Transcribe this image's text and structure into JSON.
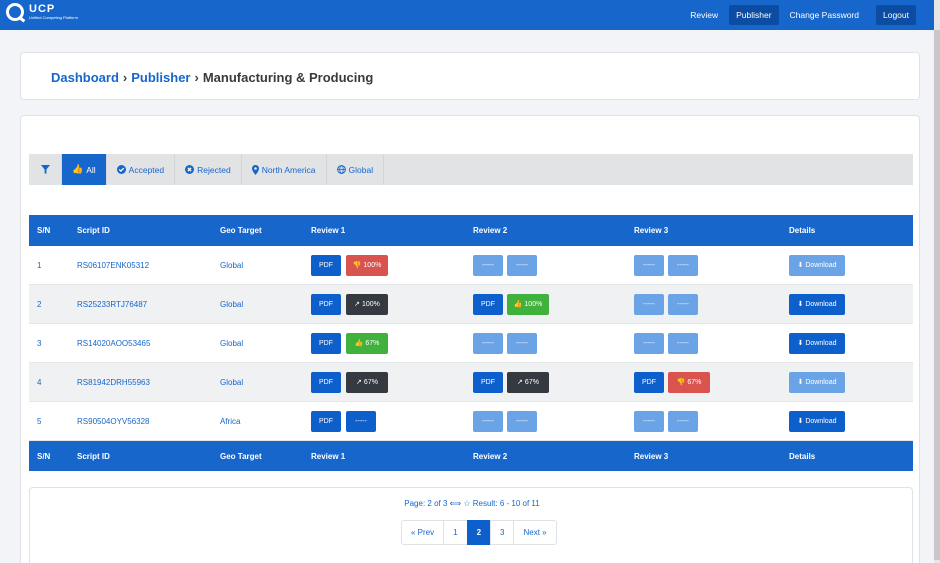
{
  "brand": {
    "name": "UCP",
    "tagline": "Unified Competing Platform"
  },
  "nav": {
    "review": "Review",
    "publisher": "Publisher",
    "change_password": "Change Password",
    "logout": "Logout"
  },
  "breadcrumb": {
    "dashboard": "Dashboard",
    "publisher": "Publisher",
    "current": "Manufacturing & Producing",
    "separator": "›"
  },
  "filters": {
    "all": "All",
    "accepted": "Accepted",
    "rejected": "Rejected",
    "north_america": "North America",
    "global": "Global"
  },
  "table": {
    "headers": {
      "sn": "S/N",
      "script_id": "Script ID",
      "geo": "Geo Target",
      "r1": "Review 1",
      "r2": "Review 2",
      "r3": "Review 3",
      "details": "Details"
    },
    "pdf_label": "PDF",
    "dash_label": "-----",
    "download_label": "Download",
    "rows": [
      {
        "sn": "1",
        "id": "RS06107ENK05312",
        "geo": "Global",
        "r1_result": "100%",
        "r2_result": "",
        "r3_result": ""
      },
      {
        "sn": "2",
        "id": "RS25233RTJ76487",
        "geo": "Global",
        "r1_result": "100%",
        "r2_result": "100%",
        "r3_result": ""
      },
      {
        "sn": "3",
        "id": "RS14020AOO53465",
        "geo": "Global",
        "r1_result": "67%",
        "r2_result": "",
        "r3_result": ""
      },
      {
        "sn": "4",
        "id": "RS81942DRH55963",
        "geo": "Global",
        "r1_result": "67%",
        "r2_result": "67%",
        "r3_result": "67%"
      },
      {
        "sn": "5",
        "id": "RS90504OYV56328",
        "geo": "Africa",
        "r1_result": "-----",
        "r2_result": "",
        "r3_result": ""
      }
    ]
  },
  "pagination": {
    "summary": "Page: 2 of 3 ⟺ ☆ Result: 6 - 10 of 11",
    "prev": "« Prev",
    "pages": [
      "1",
      "2",
      "3"
    ],
    "next": "Next »"
  },
  "colors": {
    "primary": "#1766cc",
    "dark": "#343a40",
    "danger": "#d9534f",
    "success": "#41b13d",
    "faded": "#6aa4e6"
  }
}
